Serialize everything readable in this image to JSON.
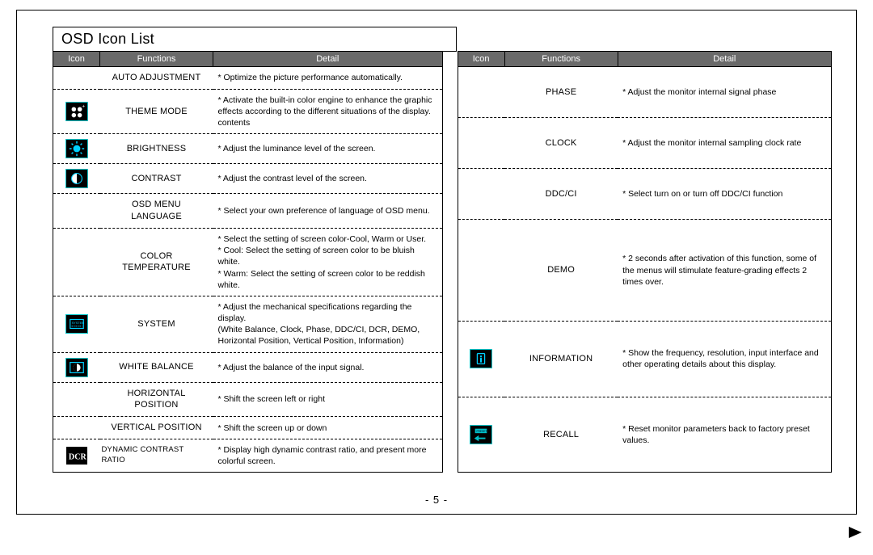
{
  "title": "OSD Icon List",
  "headers": {
    "icon": "Icon",
    "functions": "Functions",
    "detail": "Detail"
  },
  "pagenum": "- 5 -",
  "left": [
    {
      "icon": "",
      "func": "AUTO ADJUSTMENT",
      "detail": "* Optimize the picture performance automatically."
    },
    {
      "icon": "theme",
      "func": "THEME MODE",
      "detail": "* Activate the built-in color engine to enhance the graphic effects according to the different situations of the display. contents"
    },
    {
      "icon": "bright",
      "func": "BRIGHTNESS",
      "detail": "* Adjust the luminance level of the screen."
    },
    {
      "icon": "contrast",
      "func": "CONTRAST",
      "detail": "* Adjust the contrast level of the screen."
    },
    {
      "icon": "",
      "func": "OSD MENU LANGUAGE",
      "detail": "* Select your own preference of language of OSD menu."
    },
    {
      "icon": "",
      "func": "COLOR TEMPERATURE",
      "detail": "* Select the setting of screen color-Cool, Warm or User.\n* Cool: Select the setting of screen color to be bluish white.\n* Warm: Select the setting of screen color to be reddish white."
    },
    {
      "icon": "system",
      "func": "SYSTEM",
      "detail": "* Adjust the mechanical specifications regarding the display.\n   (White Balance, Clock, Phase, DDC/CI, DCR, DEMO,\n   Horizontal Position, Vertical Position, Information)"
    },
    {
      "icon": "wb",
      "func": "WHITE BALANCE",
      "detail": "* Adjust the balance of the input signal."
    },
    {
      "icon": "",
      "func": "HORIZONTAL POSITION",
      "detail": "* Shift the screen left or right"
    },
    {
      "icon": "",
      "func": "VERTICAL POSITION",
      "detail": "* Shift the screen up or down"
    },
    {
      "icon": "dcr",
      "func": "DYNAMIC CONTRAST RATIO",
      "detail": "* Display high dynamic contrast ratio, and present more colorful screen."
    }
  ],
  "right": [
    {
      "icon": "",
      "func": "PHASE",
      "detail": "* Adjust the monitor internal signal phase"
    },
    {
      "icon": "",
      "func": "CLOCK",
      "detail": "* Adjust the monitor internal sampling clock rate"
    },
    {
      "icon": "",
      "func": "DDC/CI",
      "detail": "* Select turn on or turn off DDC/CI function"
    },
    {
      "icon": "",
      "func": "DEMO",
      "detail": "* 2 seconds after activation of this function, some of the menus will stimulate feature-grading effects 2 times over."
    },
    {
      "icon": "info",
      "func": "INFORMATION",
      "detail": "* Show the frequency, resolution, input interface and other operating details about this display."
    },
    {
      "icon": "recall",
      "func": "RECALL",
      "detail": "* Reset monitor parameters back to factory preset values."
    }
  ]
}
